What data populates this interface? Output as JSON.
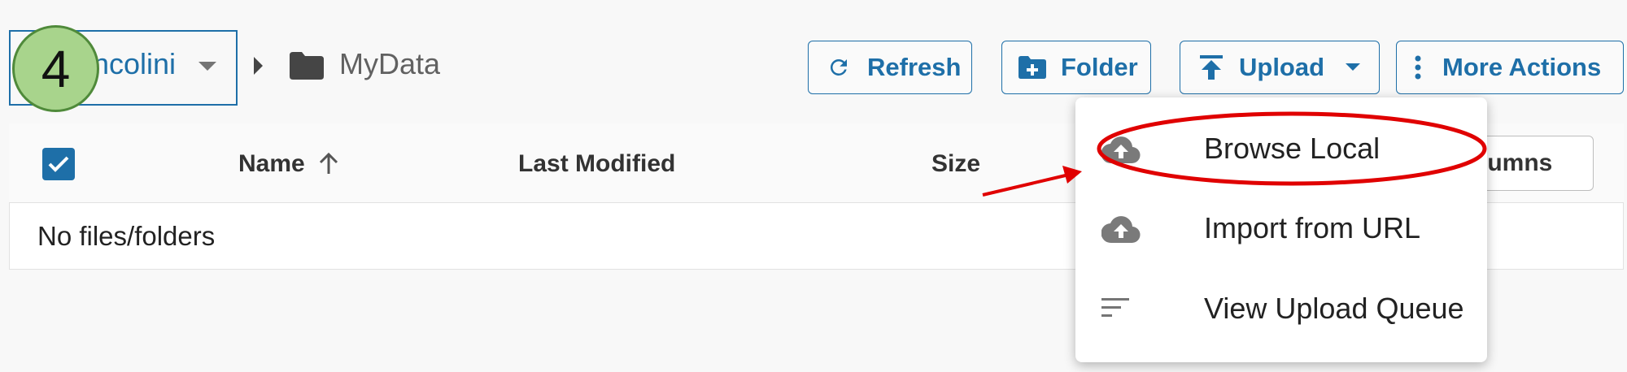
{
  "breadcrumb": {
    "user": "ncolini",
    "folder": "MyData"
  },
  "step_badge": "4",
  "toolbar": {
    "refresh_label": "Refresh",
    "folder_label": "Folder",
    "upload_label": "Upload",
    "more_actions_label": "More Actions"
  },
  "table": {
    "columns": [
      "Name",
      "Last Modified",
      "Size"
    ],
    "sort": {
      "column": "Name",
      "direction": "ascending"
    },
    "columns_button": "Columns",
    "empty_message": "No files/folders"
  },
  "upload_menu": {
    "items": [
      {
        "label": "Browse Local",
        "icon": "cloud-upload-icon",
        "highlighted": true
      },
      {
        "label": "Import from URL",
        "icon": "cloud-upload-icon"
      },
      {
        "label": "View Upload Queue",
        "icon": "queue-list-icon"
      }
    ]
  },
  "colors": {
    "accent": "#1e6fa8",
    "annotation": "#e00000",
    "badge": "#a8d48c"
  }
}
